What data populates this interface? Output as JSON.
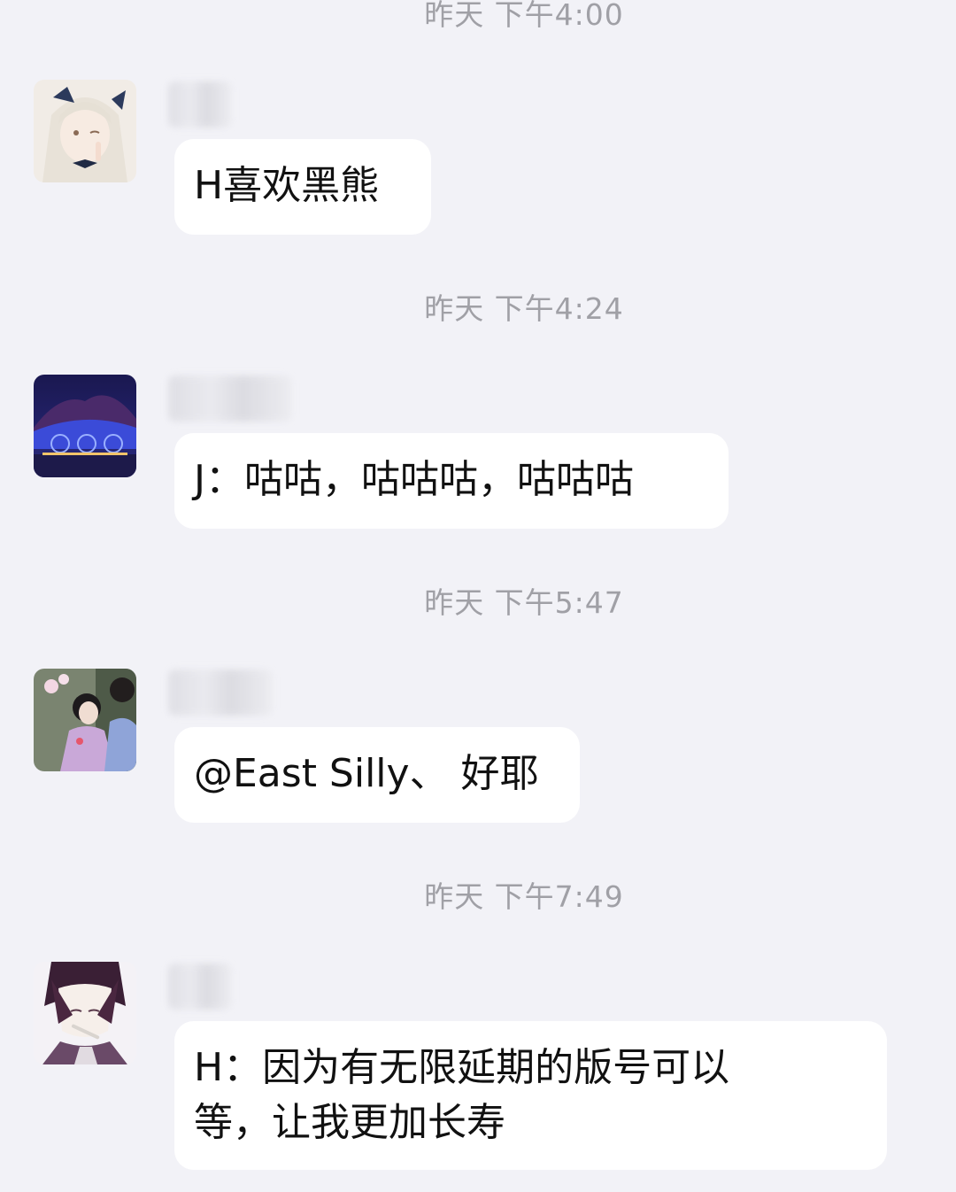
{
  "messages": [
    {
      "timestamp": "昨天 下午4:00",
      "avatar": "avatar-anime-girl-icon",
      "text": "H喜欢黑熊"
    },
    {
      "timestamp": "昨天 下午4:24",
      "avatar": "avatar-night-stadium-icon",
      "text": "J：咕咕，咕咕咕，咕咕咕"
    },
    {
      "timestamp": "昨天 下午5:47",
      "avatar": "avatar-kimono-couple-icon",
      "text": "@East Silly、 好耶"
    },
    {
      "timestamp": "昨天 下午7:49",
      "avatar": "avatar-anime-boy-icon",
      "text_line1": "H：因为有无限延期的版号可以",
      "text_line2": "等，让我更加长寿"
    }
  ],
  "colors": {
    "background": "#f2f2f7",
    "bubble": "#ffffff",
    "timestamp": "#a0a0a6"
  }
}
